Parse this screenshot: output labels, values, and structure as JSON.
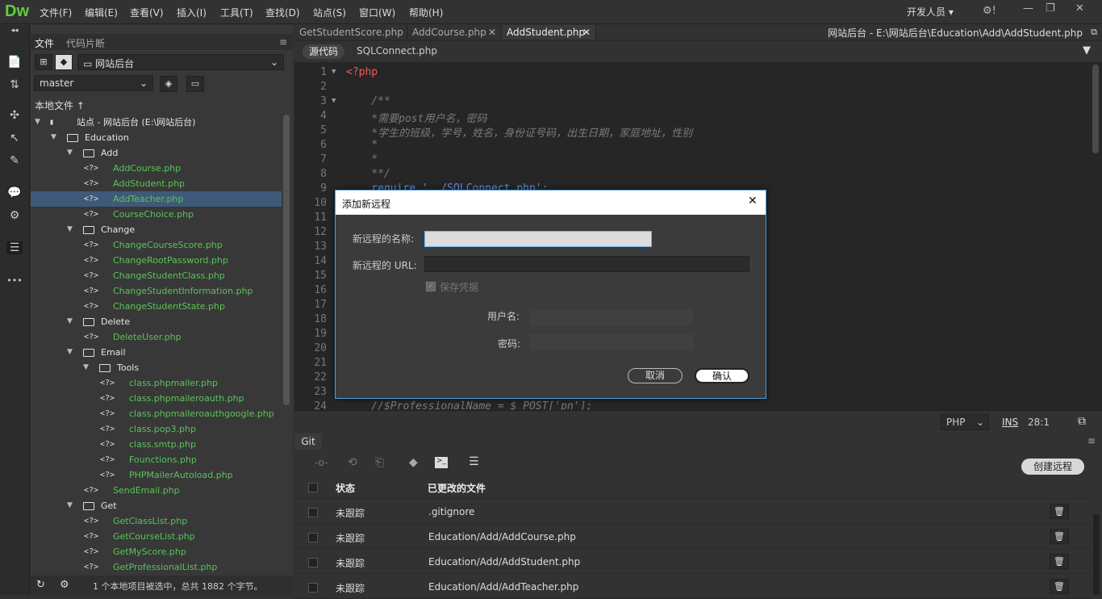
{
  "app": {
    "logo": "Dw",
    "menus": [
      "文件(F)",
      "编辑(E)",
      "查看(V)",
      "插入(I)",
      "工具(T)",
      "查找(D)",
      "站点(S)",
      "窗口(W)",
      "帮助(H)"
    ],
    "workspace": "开发人员",
    "workspace_arrow": "▾",
    "settings_icon": "⚙!",
    "window_controls": [
      "—",
      "❐",
      "✕"
    ]
  },
  "left_tools": {
    "collapse": "◂◂",
    "items": [
      "📄",
      "⇅",
      "✣",
      "↖",
      "✎",
      "💬",
      "⚙",
      "☰",
      "•••"
    ]
  },
  "files_panel": {
    "tabs": [
      "文件",
      "代码片断"
    ],
    "menu_icon": "≡",
    "site_select": "网站后台",
    "branch_select": "master",
    "header": "本地文件 ↑",
    "tree": [
      {
        "label": "站点 - 网站后台 (E:\\网站后台)",
        "level": 0,
        "kind": "site",
        "open": true
      },
      {
        "label": "Education",
        "level": 1,
        "kind": "dir",
        "open": true
      },
      {
        "label": "Add",
        "level": 2,
        "kind": "dir",
        "open": true
      },
      {
        "label": "AddCourse.php",
        "level": 3,
        "kind": "php"
      },
      {
        "label": "AddStudent.php",
        "level": 3,
        "kind": "php"
      },
      {
        "label": "AddTeacher.php",
        "level": 3,
        "kind": "php",
        "active": true
      },
      {
        "label": "CourseChoice.php",
        "level": 3,
        "kind": "php"
      },
      {
        "label": "Change",
        "level": 2,
        "kind": "dir",
        "open": true
      },
      {
        "label": "ChangeCourseScore.php",
        "level": 3,
        "kind": "php"
      },
      {
        "label": "ChangeRootPassword.php",
        "level": 3,
        "kind": "php"
      },
      {
        "label": "ChangeStudentClass.php",
        "level": 3,
        "kind": "php"
      },
      {
        "label": "ChangeStudentInformation.php",
        "level": 3,
        "kind": "php"
      },
      {
        "label": "ChangeStudentState.php",
        "level": 3,
        "kind": "php"
      },
      {
        "label": "Delete",
        "level": 2,
        "kind": "dir",
        "open": true
      },
      {
        "label": "DeleteUser.php",
        "level": 3,
        "kind": "php"
      },
      {
        "label": "Email",
        "level": 2,
        "kind": "dir",
        "open": true
      },
      {
        "label": "Tools",
        "level": 3,
        "kind": "dir",
        "open": true
      },
      {
        "label": "class.phpmailer.php",
        "level": 4,
        "kind": "php"
      },
      {
        "label": "class.phpmaileroauth.php",
        "level": 4,
        "kind": "php"
      },
      {
        "label": "class.phpmaileroauthgoogle.php",
        "level": 4,
        "kind": "php"
      },
      {
        "label": "class.pop3.php",
        "level": 4,
        "kind": "php"
      },
      {
        "label": "class.smtp.php",
        "level": 4,
        "kind": "php"
      },
      {
        "label": "Founctions.php",
        "level": 4,
        "kind": "php"
      },
      {
        "label": "PHPMailerAutoload.php",
        "level": 4,
        "kind": "php"
      },
      {
        "label": "SendEmail.php",
        "level": 3,
        "kind": "php"
      },
      {
        "label": "Get",
        "level": 2,
        "kind": "dir",
        "open": true
      },
      {
        "label": "GetClassList.php",
        "level": 3,
        "kind": "php"
      },
      {
        "label": "GetCourseList.php",
        "level": 3,
        "kind": "php"
      },
      {
        "label": "GetMyScore.php",
        "level": 3,
        "kind": "php"
      },
      {
        "label": "GetProfessionalList.php",
        "level": 3,
        "kind": "php"
      }
    ],
    "status": "1 个本地项目被选中，总共 1882 个字节。"
  },
  "editor": {
    "tabs": [
      {
        "label": "GetStudentScore.php",
        "close": "✕"
      },
      {
        "label": "AddCourse.php",
        "close": "✕"
      },
      {
        "label": "AddStudent.php",
        "close": "✕",
        "active": true
      }
    ],
    "path": "网站后台 - E:\\网站后台\\Education\\Add\\AddStudent.php",
    "subtabs": [
      "源代码",
      "SQLConnect.php"
    ],
    "filter_icon": "▼",
    "lines": [
      {
        "n": "1",
        "fold": "▼",
        "text": "<?php",
        "cls": "k"
      },
      {
        "n": "2",
        "text": ""
      },
      {
        "n": "3",
        "fold": "▼",
        "text": "    /**",
        "cls": "c"
      },
      {
        "n": "4",
        "text": "    *需要post用户名，密码",
        "cls": "c"
      },
      {
        "n": "5",
        "text": "    *学生的班级，学号，姓名，身份证号码，出生日期，家庭地址，性别",
        "cls": "c"
      },
      {
        "n": "6",
        "text": "    *",
        "cls": "c"
      },
      {
        "n": "7",
        "text": "    *",
        "cls": "c"
      },
      {
        "n": "8",
        "text": "    **/",
        "cls": "c"
      },
      {
        "n": "9",
        "text": "    require '../SQLConnect.php';",
        "cls": "b"
      },
      {
        "n": "10",
        "text": ""
      },
      {
        "n": "11",
        "text": ""
      },
      {
        "n": "12",
        "text": ""
      },
      {
        "n": "13",
        "text": ""
      },
      {
        "n": "14",
        "text": ""
      },
      {
        "n": "15",
        "text": ""
      },
      {
        "n": "16",
        "text": ""
      },
      {
        "n": "17",
        "text": ""
      },
      {
        "n": "18",
        "text": ""
      },
      {
        "n": "19",
        "text": ""
      },
      {
        "n": "20",
        "text": ""
      },
      {
        "n": "21",
        "text": ""
      },
      {
        "n": "22",
        "text": ""
      },
      {
        "n": "23",
        "text": ""
      },
      {
        "n": "24",
        "text": "    //$ProfessionalName = $_POST['pn'];",
        "cls": "c"
      }
    ],
    "status": {
      "lang": "PHP",
      "mode": "INS",
      "pos": "28:1"
    }
  },
  "git": {
    "tab": "Git",
    "create_remote": "创建远程",
    "columns": [
      "状态",
      "已更改的文件"
    ],
    "rows": [
      {
        "status": "未跟踪",
        "file": ".gitignore"
      },
      {
        "status": "未跟踪",
        "file": "Education/Add/AddCourse.php"
      },
      {
        "status": "未跟踪",
        "file": "Education/Add/AddStudent.php"
      },
      {
        "status": "未跟踪",
        "file": "Education/Add/AddTeacher.php"
      }
    ]
  },
  "dialog": {
    "title": "添加新远程",
    "close": "✕",
    "name_label": "新远程的名称:",
    "name_value": "",
    "url_label": "新远程的 URL:",
    "url_value": "",
    "save_credentials": "保存凭据",
    "username_label": "用户名:",
    "password_label": "密码:",
    "cancel": "取消",
    "ok": "确认"
  }
}
